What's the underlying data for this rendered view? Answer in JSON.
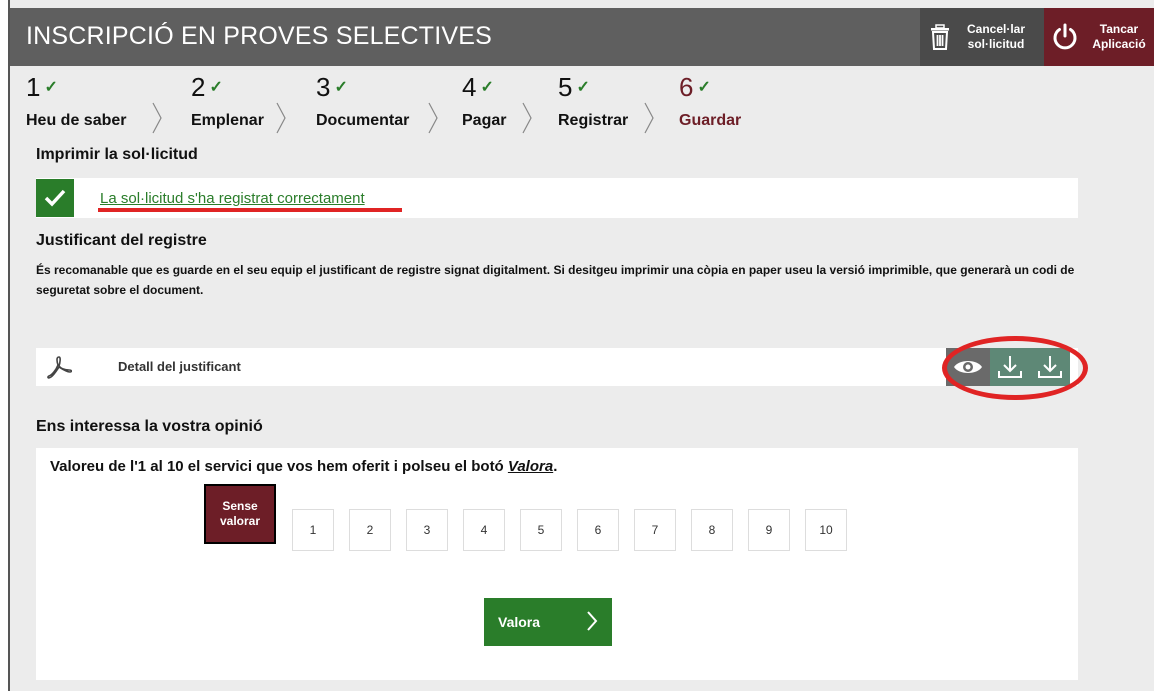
{
  "header": {
    "title": "INSCRIPCIÓ EN PROVES SELECTIVES",
    "cancel_label_line1": "Cancel·lar",
    "cancel_label_line2": "sol·licitud",
    "close_label_line1": "Tancar",
    "close_label_line2": "Aplicació"
  },
  "steps": [
    {
      "num": "1",
      "label": "Heu de saber"
    },
    {
      "num": "2",
      "label": "Emplenar"
    },
    {
      "num": "3",
      "label": "Documentar"
    },
    {
      "num": "4",
      "label": "Pagar"
    },
    {
      "num": "5",
      "label": "Registrar"
    },
    {
      "num": "6",
      "label": "Guardar"
    }
  ],
  "print_section": {
    "title": "Imprimir la sol·licitud",
    "success_message": "La sol·licitud s'ha registrat correctament"
  },
  "receipt": {
    "title": "Justificant del registre",
    "description": "És recomanable que es guarde en el seu equip el justificant de registre signat digitalment. Si desitgeu imprimir una còpia en paper useu la versió imprimible, que generarà un codi de seguretat sobre el document.",
    "document_label": "Detall del justificant"
  },
  "opinion": {
    "title": "Ens interessa la vostra opinió",
    "question_prefix": "Valoreu de l'1 al 10 el servici que vos hem oferit i polseu el botó ",
    "question_link": "Valora",
    "question_suffix": ".",
    "no_rating_line1": "Sense",
    "no_rating_line2": "valorar",
    "scores": [
      "1",
      "2",
      "3",
      "4",
      "5",
      "6",
      "7",
      "8",
      "9",
      "10"
    ],
    "submit_label": "Valora"
  },
  "colors": {
    "header_bg": "#5f5f5f",
    "brand_maroon": "#6d1e27",
    "success_green": "#2a7d2a",
    "annotation_red": "#e02424"
  }
}
